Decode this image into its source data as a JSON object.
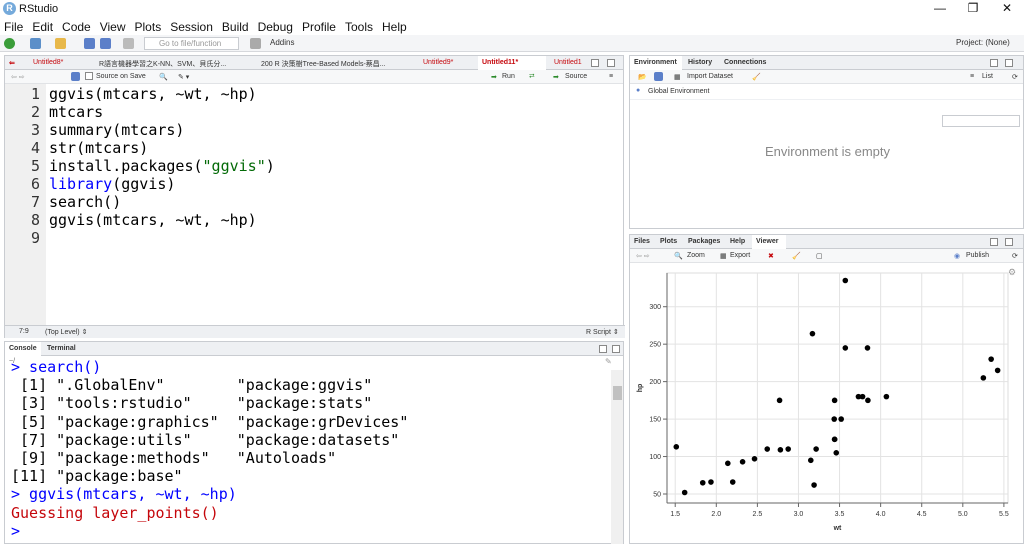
{
  "window": {
    "title": "RStudio",
    "minimize": "—",
    "restore": "❐",
    "close": "✕"
  },
  "menu": [
    "File",
    "Edit",
    "Code",
    "View",
    "Plots",
    "Session",
    "Build",
    "Debug",
    "Profile",
    "Tools",
    "Help"
  ],
  "toolbar": {
    "goto_placeholder": "Go to file/function",
    "addins": "Addins",
    "project": "Project: (None)"
  },
  "editor": {
    "tabs": [
      {
        "label": "Untitled8*",
        "modified": true
      },
      {
        "label": "R語言機器學習之K-NN、SVM、貝氏分...",
        "modified": false
      },
      {
        "label": "200 R 決策樹Tree-Based Models-蔡昌...",
        "modified": false
      },
      {
        "label": "Untitled9*",
        "modified": true
      },
      {
        "label": "Untitled11*",
        "modified": true
      },
      {
        "label": "Untitled1",
        "modified": true
      }
    ],
    "source_on_save": "Source on Save",
    "run_label": "Run",
    "source_label": "Source",
    "line_numbers": [
      "1",
      "2",
      "3",
      "4",
      "5",
      "6",
      "7",
      "8",
      "9"
    ],
    "lines": [
      [
        {
          "t": "ggvis(mtcars, ~wt, ~hp)",
          "c": ""
        }
      ],
      [
        {
          "t": "mtcars",
          "c": ""
        }
      ],
      [
        {
          "t": "summary(mtcars)",
          "c": ""
        }
      ],
      [
        {
          "t": "str(mtcars)",
          "c": ""
        }
      ],
      [
        {
          "t": "install.packages(",
          "c": ""
        },
        {
          "t": "\"ggvis\"",
          "c": "str"
        },
        {
          "t": ")",
          "c": ""
        }
      ],
      [
        {
          "t": "library",
          "c": "kw"
        },
        {
          "t": "(ggvis)",
          "c": ""
        }
      ],
      [
        {
          "t": "search()",
          "c": ""
        }
      ],
      [
        {
          "t": "ggvis(mtcars, ~wt, ~hp)",
          "c": ""
        }
      ],
      [
        {
          "t": "",
          "c": ""
        }
      ]
    ],
    "cursor_pos": "7:9",
    "scope": "(Top Level) ⇕",
    "file_type": "R Script ⇕"
  },
  "console": {
    "tabs": [
      "Console",
      "Terminal"
    ],
    "path": "~/",
    "lines": [
      {
        "t": "> search()",
        "c": "cblue"
      },
      {
        "t": " [1] \".GlobalEnv\"        \"package:ggvis\"",
        "c": ""
      },
      {
        "t": " [3] \"tools:rstudio\"     \"package:stats\"",
        "c": ""
      },
      {
        "t": " [5] \"package:graphics\"  \"package:grDevices\"",
        "c": ""
      },
      {
        "t": " [7] \"package:utils\"     \"package:datasets\"",
        "c": ""
      },
      {
        "t": " [9] \"package:methods\"   \"Autoloads\"",
        "c": ""
      },
      {
        "t": "[11] \"package:base\"",
        "c": ""
      },
      {
        "t": "> ggvis(mtcars, ~wt, ~hp)",
        "c": "cblue"
      },
      {
        "t": "Guessing layer_points()",
        "c": "cred"
      },
      {
        "t": "> ",
        "c": "cblue"
      }
    ]
  },
  "environment": {
    "tabs": [
      "Environment",
      "History",
      "Connections"
    ],
    "import_dataset": "Import Dataset",
    "list": "List",
    "scope": "Global Environment",
    "empty_msg": "Environment is empty"
  },
  "viewer": {
    "tabs": [
      "Files",
      "Plots",
      "Packages",
      "Help",
      "Viewer"
    ],
    "zoom": "Zoom",
    "export": "Export",
    "publish": "Publish"
  },
  "chart_data": {
    "type": "scatter",
    "xlabel": "wt",
    "ylabel": "hp",
    "xlim": [
      1.4,
      5.55
    ],
    "ylim": [
      38,
      345
    ],
    "xticks": [
      1.5,
      2.0,
      2.5,
      3.0,
      3.5,
      4.0,
      4.5,
      5.0,
      5.5
    ],
    "xtick_labels": [
      "1.5",
      "2.0",
      "2.5",
      "3.0",
      "3.5",
      "4.0",
      "4.5",
      "5.0",
      "5.5"
    ],
    "yticks": [
      50,
      100,
      150,
      200,
      250,
      300
    ],
    "ytick_labels": [
      "50",
      "100",
      "150",
      "200",
      "250",
      "300"
    ],
    "grid": true,
    "x": [
      2.62,
      2.875,
      2.32,
      3.215,
      3.44,
      3.46,
      3.57,
      3.19,
      3.15,
      3.44,
      3.44,
      4.07,
      3.73,
      3.78,
      5.25,
      5.424,
      5.345,
      2.2,
      1.615,
      1.835,
      2.465,
      3.52,
      3.435,
      3.84,
      3.845,
      1.935,
      2.14,
      1.513,
      3.17,
      2.77,
      3.57,
      2.78
    ],
    "y": [
      110,
      110,
      93,
      110,
      175,
      105,
      245,
      62,
      95,
      123,
      123,
      180,
      180,
      180,
      205,
      215,
      230,
      66,
      52,
      65,
      97,
      150,
      150,
      245,
      175,
      66,
      91,
      113,
      264,
      175,
      335,
      109
    ]
  }
}
